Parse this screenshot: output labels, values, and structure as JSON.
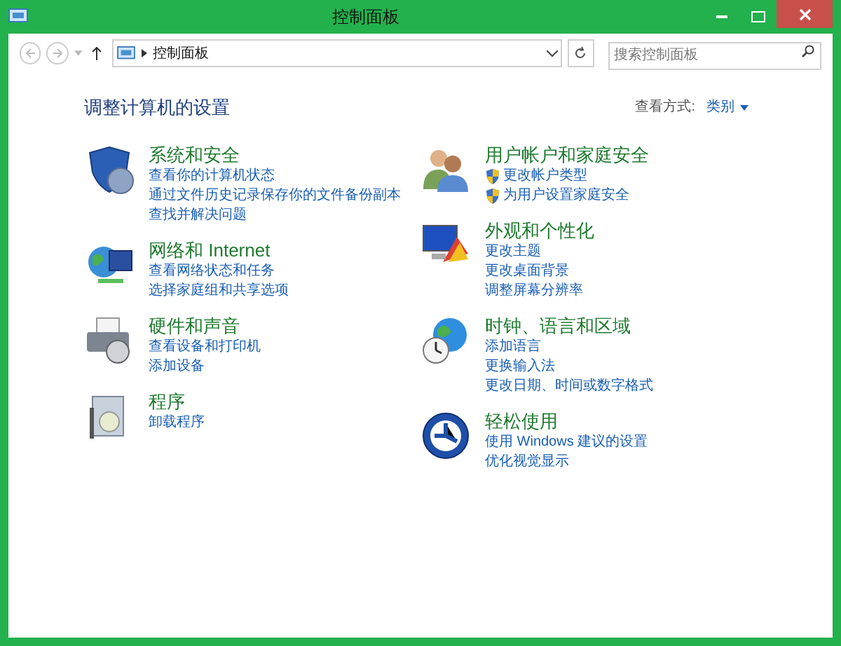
{
  "window": {
    "title": "控制面板"
  },
  "address_bar": {
    "path": "控制面板"
  },
  "search": {
    "placeholder": "搜索控制面板"
  },
  "heading": "调整计算机的设置",
  "view_by": {
    "label": "查看方式:",
    "value": "类别"
  },
  "columns": [
    [
      {
        "kind": "security",
        "title": "系统和安全",
        "links": [
          {
            "text": "查看你的计算机状态",
            "kind": "plain"
          },
          {
            "text": "通过文件历史记录保存你的文件备份副本",
            "kind": "plain"
          },
          {
            "text": "查找并解决问题",
            "kind": "plain"
          }
        ]
      },
      {
        "kind": "network",
        "title": "网络和 Internet",
        "links": [
          {
            "text": "查看网络状态和任务",
            "kind": "plain"
          },
          {
            "text": "选择家庭组和共享选项",
            "kind": "plain"
          }
        ]
      },
      {
        "kind": "hardware",
        "title": "硬件和声音",
        "links": [
          {
            "text": "查看设备和打印机",
            "kind": "plain"
          },
          {
            "text": "添加设备",
            "kind": "plain"
          }
        ]
      },
      {
        "kind": "programs",
        "title": "程序",
        "links": [
          {
            "text": "卸载程序",
            "kind": "plain"
          }
        ]
      }
    ],
    [
      {
        "kind": "users",
        "title": "用户帐户和家庭安全",
        "links": [
          {
            "text": "更改帐户类型",
            "kind": "admin"
          },
          {
            "text": "为用户设置家庭安全",
            "kind": "admin"
          }
        ]
      },
      {
        "kind": "appearance",
        "title": "外观和个性化",
        "links": [
          {
            "text": "更改主题",
            "kind": "plain"
          },
          {
            "text": "更改桌面背景",
            "kind": "plain"
          },
          {
            "text": "调整屏幕分辨率",
            "kind": "plain"
          }
        ]
      },
      {
        "kind": "clock",
        "title": "时钟、语言和区域",
        "links": [
          {
            "text": "添加语言",
            "kind": "plain"
          },
          {
            "text": "更换输入法",
            "kind": "plain"
          },
          {
            "text": "更改日期、时间或数字格式",
            "kind": "plain"
          }
        ]
      },
      {
        "kind": "ease",
        "title": "轻松使用",
        "links": [
          {
            "text": "使用 Windows 建议的设置",
            "kind": "plain"
          },
          {
            "text": "优化视觉显示",
            "kind": "plain"
          }
        ]
      }
    ]
  ]
}
